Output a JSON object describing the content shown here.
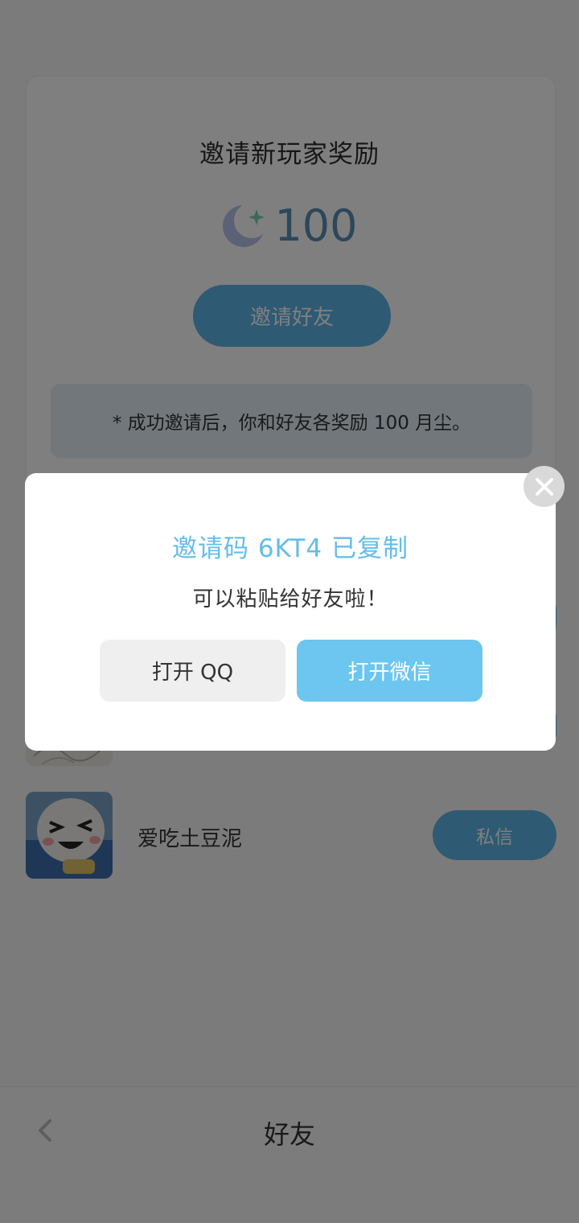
{
  "invite_card": {
    "title": "邀请新玩家奖励",
    "reward_amount": "100",
    "reward_icon": "moon-star-icon",
    "invite_button_label": "邀请好友",
    "tip": "* 成功邀请后，你和好友各奖励 100 月尘。"
  },
  "friends": [
    {
      "name": "爱吃土豆泥",
      "dm_label": "私信"
    }
  ],
  "bottom_bar": {
    "back_icon": "chevron-left-icon",
    "title": "好友"
  },
  "dialog": {
    "title": "邀请码 6KT4 已复制",
    "message": "可以粘贴给好友啦！",
    "qq_button_label": "打开 QQ",
    "wechat_button_label": "打开微信",
    "close_icon": "close-icon"
  },
  "colors": {
    "accent_blue": "#6cc6ef",
    "title_blue": "#63bde9",
    "overlay": "rgba(0,0,0,0.5)"
  }
}
